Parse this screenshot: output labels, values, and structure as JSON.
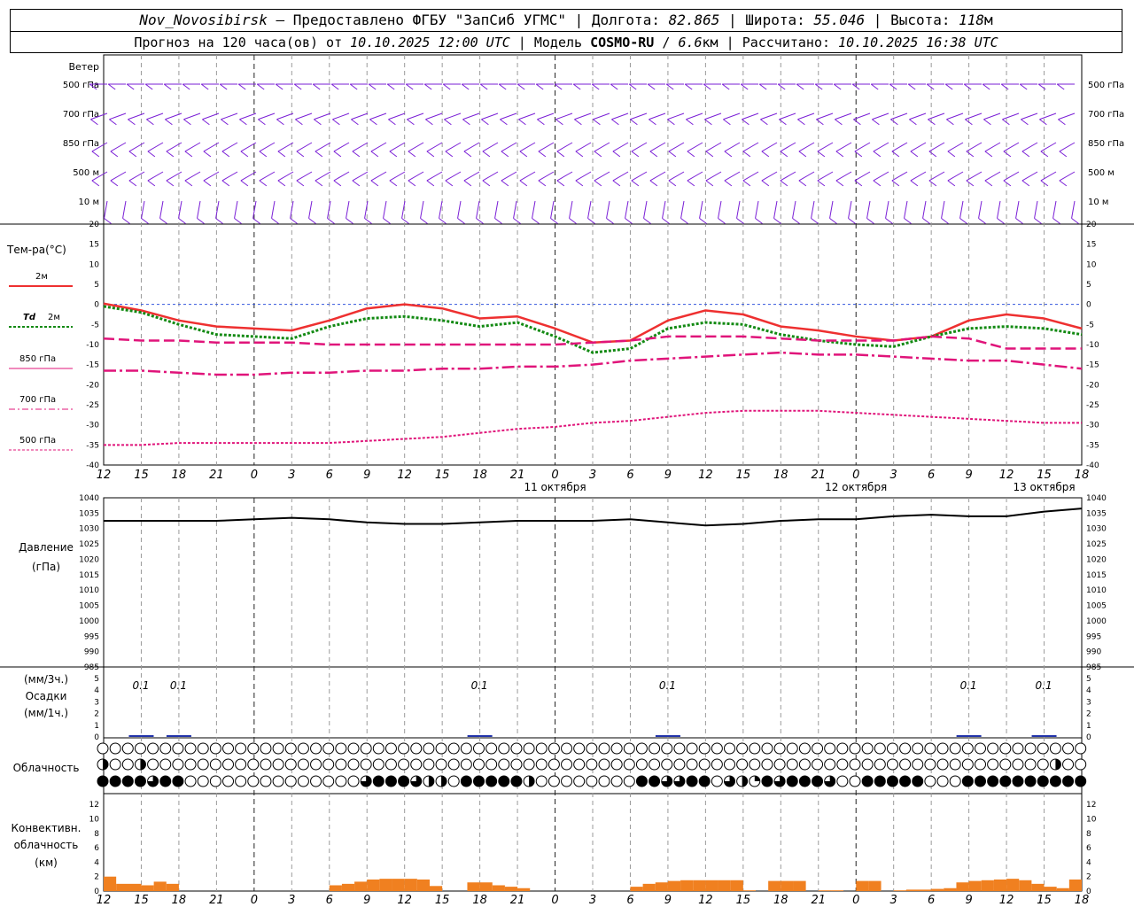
{
  "header": {
    "station": "Nov_Novosibirsk",
    "dash": " – ",
    "provided": "Предоставлено ФГБУ \"ЗапСиб УГМС\"",
    "sep": " | ",
    "lon_label": "Долгота: ",
    "lon_value": "82.865",
    "lat_label": "Широта: ",
    "lat_value": "55.046",
    "alt_label": "Высота: ",
    "alt_value": "118",
    "alt_unit": "м",
    "forecast_label": "Прогноз на 120 часа(ов) от ",
    "forecast_from": "10.10.2025 12:00 UTC",
    "model_label": "Модель ",
    "model_name": "COSMO-RU",
    "model_res_sep": " / ",
    "model_res": "6.6",
    "model_res_unit": "км",
    "calc_label": "Рассчитано: ",
    "calc_value": "10.10.2025 16:38 UTC"
  },
  "labels": {
    "wind_title": "Ветер",
    "wind_levels": [
      "500 гПа",
      "700 гПа",
      "850 гПа",
      "500  м",
      "10  м"
    ],
    "temp_title": "Тем-ра(°C)",
    "legend_2m": "2м",
    "legend_td": "Td",
    "legend_td_2m": "2м",
    "legend_850": "850 гПа",
    "legend_700": "700 гПа",
    "legend_500": "500 гПа",
    "pressure_title": "Давление",
    "pressure_unit": "(гПа)",
    "precip_unit1": "(мм/3ч.)",
    "precip_title": "Осадки",
    "precip_unit2": "(мм/1ч.)",
    "cloud_title": "Облачность",
    "conv_title1": "Конвективн.",
    "conv_title2": "облачность",
    "conv_unit": "(км)"
  },
  "axes": {
    "hour_ticks": [
      "12",
      "15",
      "18",
      "21",
      "0",
      "3",
      "6",
      "9",
      "12",
      "15",
      "18",
      "21",
      "0",
      "3",
      "6",
      "9",
      "12",
      "15",
      "18",
      "21",
      "0",
      "3",
      "6",
      "9",
      "12",
      "15",
      "18"
    ],
    "date_labels": [
      "11 октября",
      "12 октября",
      "13 октября"
    ],
    "temp_ticks": [
      "20",
      "15",
      "10",
      "5",
      "0",
      "-5",
      "-10",
      "-15",
      "-20",
      "-25",
      "-30",
      "-35",
      "-40"
    ],
    "pressure_ticks": [
      "1040",
      "1035",
      "1030",
      "1025",
      "1020",
      "1015",
      "1010",
      "1005",
      "1000",
      "995",
      "990",
      "985"
    ],
    "precip_ticks": [
      "5",
      "4",
      "3",
      "2",
      "1",
      "0"
    ],
    "conv_ticks": [
      "12",
      "10",
      "8",
      "6",
      "4",
      "2",
      "0"
    ]
  },
  "colors": {
    "wind": "#7a1fd6",
    "t2m": "#ee3030",
    "td2m": "#138a13",
    "levels": "#e0147a",
    "zero_line": "#3355dd",
    "pressure": "#000000",
    "precip": "#2233aa",
    "conv": "#f08020"
  },
  "chart_data": {
    "type": "line",
    "x_hours_from_start": [
      0,
      3,
      6,
      9,
      12,
      15,
      18,
      21,
      24,
      27,
      30,
      33,
      36,
      39,
      42,
      45,
      48,
      51,
      54,
      57,
      60,
      63,
      66,
      69,
      72,
      75,
      78
    ],
    "series": [
      {
        "name": "2м",
        "values": [
          0.2,
          -1.5,
          -4,
          -5.5,
          -6,
          -6.5,
          -4,
          -1,
          0,
          -1,
          -3.5,
          -3,
          -6,
          -9.5,
          -9,
          -4,
          -1.5,
          -2.5,
          -5.5,
          -6.5,
          -8,
          -9,
          -8,
          -4,
          -2.5,
          -3.5,
          -6
        ]
      },
      {
        "name": "Td 2м",
        "values": [
          -0.5,
          -2,
          -5,
          -7.5,
          -8,
          -8.5,
          -5.5,
          -3.5,
          -3,
          -4,
          -5.5,
          -4.5,
          -8,
          -12,
          -11,
          -6,
          -4.5,
          -5,
          -7.5,
          -9,
          -10,
          -10.5,
          -8,
          -6,
          -5.5,
          -6,
          -7.5
        ]
      },
      {
        "name": "850 гПа",
        "values": [
          -8.5,
          -9,
          -9,
          -9.5,
          -9.5,
          -9.5,
          -10,
          -10,
          -10,
          -10,
          -10,
          -10,
          -10,
          -9.5,
          -9,
          -8,
          -8,
          -8,
          -8.5,
          -9,
          -9,
          -9,
          -8,
          -8.5,
          -11,
          -11,
          -11
        ]
      },
      {
        "name": "700 гПа",
        "values": [
          -16.5,
          -16.5,
          -17,
          -17.5,
          -17.5,
          -17,
          -17,
          -16.5,
          -16.5,
          -16,
          -16,
          -15.5,
          -15.5,
          -15,
          -14,
          -13.5,
          -13,
          -12.5,
          -12,
          -12.5,
          -12.5,
          -13,
          -13.5,
          -14,
          -14,
          -15,
          -16
        ]
      },
      {
        "name": "500 гПа",
        "values": [
          -35,
          -35,
          -34.5,
          -34.5,
          -34.5,
          -34.5,
          -34.5,
          -34,
          -33.5,
          -33,
          -32,
          -31,
          -30.5,
          -29.5,
          -29,
          -28,
          -27,
          -26.5,
          -26.5,
          -26.5,
          -27,
          -27.5,
          -28,
          -28.5,
          -29,
          -29.5,
          -29.5
        ]
      }
    ],
    "pressure": {
      "values": [
        1032.5,
        1032.5,
        1032.5,
        1032.5,
        1033,
        1033.5,
        1033,
        1032,
        1031.5,
        1031.5,
        1032,
        1032.5,
        1032.5,
        1032.5,
        1033,
        1032,
        1031,
        1031.5,
        1032.5,
        1033,
        1033,
        1034,
        1034.5,
        1034,
        1034,
        1035.5,
        1036.5
      ],
      "ylim": [
        985,
        1040
      ]
    },
    "precip_annotations": [
      {
        "hour": 3,
        "text": "0.1"
      },
      {
        "hour": 6,
        "text": "0.1"
      },
      {
        "hour": 30,
        "text": "0.1"
      },
      {
        "hour": 45,
        "text": "0.1"
      },
      {
        "hour": 69,
        "text": "0.1"
      },
      {
        "hour": 75,
        "text": "0.1"
      }
    ],
    "convective_cloud_km": [
      {
        "start": 0,
        "end": 1,
        "value": 2
      },
      {
        "start": 1,
        "end": 3,
        "value": 1
      },
      {
        "start": 3,
        "end": 4,
        "value": 0.8
      },
      {
        "start": 4,
        "end": 5,
        "value": 1.3
      },
      {
        "start": 5,
        "end": 6,
        "value": 1
      },
      {
        "start": 18,
        "end": 19,
        "value": 0.8
      },
      {
        "start": 19,
        "end": 20,
        "value": 1
      },
      {
        "start": 20,
        "end": 21,
        "value": 1.3
      },
      {
        "start": 21,
        "end": 22,
        "value": 1.6
      },
      {
        "start": 22,
        "end": 23,
        "value": 1.7
      },
      {
        "start": 23,
        "end": 24,
        "value": 1.7
      },
      {
        "start": 24,
        "end": 25,
        "value": 1.7
      },
      {
        "start": 25,
        "end": 26,
        "value": 1.6
      },
      {
        "start": 26,
        "end": 27,
        "value": 0.7
      },
      {
        "start": 29,
        "end": 30,
        "value": 1.2
      },
      {
        "start": 30,
        "end": 31,
        "value": 1.2
      },
      {
        "start": 31,
        "end": 32,
        "value": 0.8
      },
      {
        "start": 32,
        "end": 33,
        "value": 0.6
      },
      {
        "start": 33,
        "end": 34,
        "value": 0.4
      },
      {
        "start": 42,
        "end": 43,
        "value": 0.6
      },
      {
        "start": 43,
        "end": 44,
        "value": 1.0
      },
      {
        "start": 44,
        "end": 45,
        "value": 1.2
      },
      {
        "start": 45,
        "end": 46,
        "value": 1.4
      },
      {
        "start": 46,
        "end": 47,
        "value": 1.5
      },
      {
        "start": 47,
        "end": 48,
        "value": 1.5
      },
      {
        "start": 48,
        "end": 49,
        "value": 1.5
      },
      {
        "start": 49,
        "end": 50,
        "value": 1.5
      },
      {
        "start": 50,
        "end": 51,
        "value": 1.5
      },
      {
        "start": 51,
        "end": 52,
        "value": 0.1
      },
      {
        "start": 53,
        "end": 54,
        "value": 1.4
      },
      {
        "start": 54,
        "end": 55,
        "value": 1.4
      },
      {
        "start": 55,
        "end": 56,
        "value": 1.4
      },
      {
        "start": 57,
        "end": 58,
        "value": 0.1
      },
      {
        "start": 58,
        "end": 59,
        "value": 0.1
      },
      {
        "start": 60,
        "end": 61,
        "value": 1.4
      },
      {
        "start": 61,
        "end": 62,
        "value": 1.4
      },
      {
        "start": 63,
        "end": 64,
        "value": 0.1
      },
      {
        "start": 64,
        "end": 65,
        "value": 0.2
      },
      {
        "start": 65,
        "end": 66,
        "value": 0.2
      },
      {
        "start": 66,
        "end": 67,
        "value": 0.3
      },
      {
        "start": 67,
        "end": 68,
        "value": 0.4
      },
      {
        "start": 68,
        "end": 69,
        "value": 1.2
      },
      {
        "start": 69,
        "end": 70,
        "value": 1.4
      },
      {
        "start": 70,
        "end": 71,
        "value": 1.5
      },
      {
        "start": 71,
        "end": 72,
        "value": 1.6
      },
      {
        "start": 72,
        "end": 73,
        "value": 1.7
      },
      {
        "start": 73,
        "end": 74,
        "value": 1.5
      },
      {
        "start": 74,
        "end": 75,
        "value": 1.0
      },
      {
        "start": 75,
        "end": 76,
        "value": 0.6
      },
      {
        "start": 76,
        "end": 77,
        "value": 0.4
      },
      {
        "start": 77,
        "end": 78,
        "value": 1.6
      }
    ],
    "cloud_rows": [
      {
        "name": "upper",
        "fractions": [
          0,
          0,
          0,
          0,
          0,
          0,
          0,
          0,
          0,
          0,
          0,
          0,
          0,
          0,
          0,
          0,
          0,
          0,
          0,
          0,
          0,
          0,
          0,
          0,
          0,
          0,
          0,
          0,
          0,
          0,
          0,
          0,
          0,
          0,
          0,
          0,
          0,
          0,
          0,
          0,
          0,
          0,
          0,
          0,
          0,
          0,
          0,
          0,
          0,
          0,
          0,
          0,
          0,
          0,
          0,
          0,
          0,
          0,
          0,
          0,
          0,
          0,
          0,
          0,
          0,
          0,
          0,
          0,
          0,
          0,
          0,
          0,
          0,
          0,
          0,
          0,
          0,
          0,
          0
        ]
      },
      {
        "name": "middle",
        "fractions": [
          0.5,
          0,
          0,
          0.5,
          0,
          0,
          0,
          0,
          0,
          0,
          0,
          0,
          0,
          0,
          0,
          0,
          0,
          0,
          0,
          0,
          0,
          0,
          0,
          0,
          0,
          0,
          0,
          0,
          0,
          0,
          0,
          0,
          0,
          0,
          0,
          0,
          0,
          0,
          0,
          0,
          0,
          0,
          0,
          0,
          0,
          0,
          0,
          0,
          0,
          0,
          0,
          0,
          0,
          0,
          0,
          0,
          0,
          0,
          0,
          0,
          0,
          0,
          0,
          0,
          0,
          0,
          0,
          0,
          0,
          0,
          0,
          0,
          0,
          0,
          0,
          0,
          0.5,
          0,
          0
        ]
      },
      {
        "name": "lower",
        "fractions": [
          1,
          1,
          1,
          1,
          0.75,
          1,
          1,
          0,
          0,
          0,
          0,
          0,
          0,
          0,
          0,
          0,
          0,
          0,
          0,
          0,
          0,
          0.75,
          1,
          1,
          1,
          0.75,
          0.5,
          0.5,
          0,
          1,
          1,
          1,
          1,
          1,
          0.5,
          0,
          0,
          0,
          0,
          0,
          0,
          0,
          0,
          1,
          1,
          0.75,
          0.75,
          1,
          1,
          0,
          0.75,
          0.5,
          0.25,
          1,
          0.75,
          1,
          1,
          1,
          0.75,
          0,
          0,
          1,
          1,
          1,
          1,
          1,
          0,
          0,
          0,
          1,
          1,
          1,
          1,
          1,
          1,
          1,
          1,
          1,
          1
        ]
      }
    ],
    "wind": {
      "levels": [
        "500 гПа",
        "700 гПа",
        "850 гПа",
        "500  м",
        "10  м"
      ],
      "directions_deg": [
        270,
        250,
        240,
        240,
        190
      ],
      "speeds_knots": [
        25,
        20,
        15,
        15,
        5
      ]
    }
  }
}
